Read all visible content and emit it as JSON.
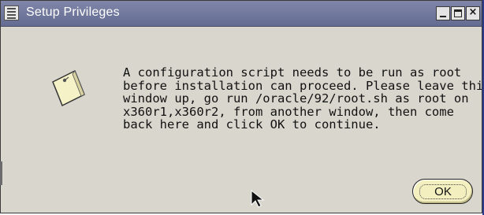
{
  "window": {
    "title": "Setup Privileges",
    "controls": {
      "minimize": "minimize",
      "maximize": "maximize",
      "close": "close"
    }
  },
  "dialog": {
    "icon": "note-icon",
    "message_lines": [
      "A configuration script needs to be run as root",
      "before installation can proceed. Please leave this",
      "window up, go run /oracle/92/root.sh as root on",
      "x360r1,x360r2, from another window, then come",
      "back here and click OK to continue."
    ],
    "ok_label": "OK"
  },
  "colors": {
    "titlebar": "#6f779c",
    "dialog_background": "#d9d6ce",
    "button_face": "#f3efbf"
  }
}
